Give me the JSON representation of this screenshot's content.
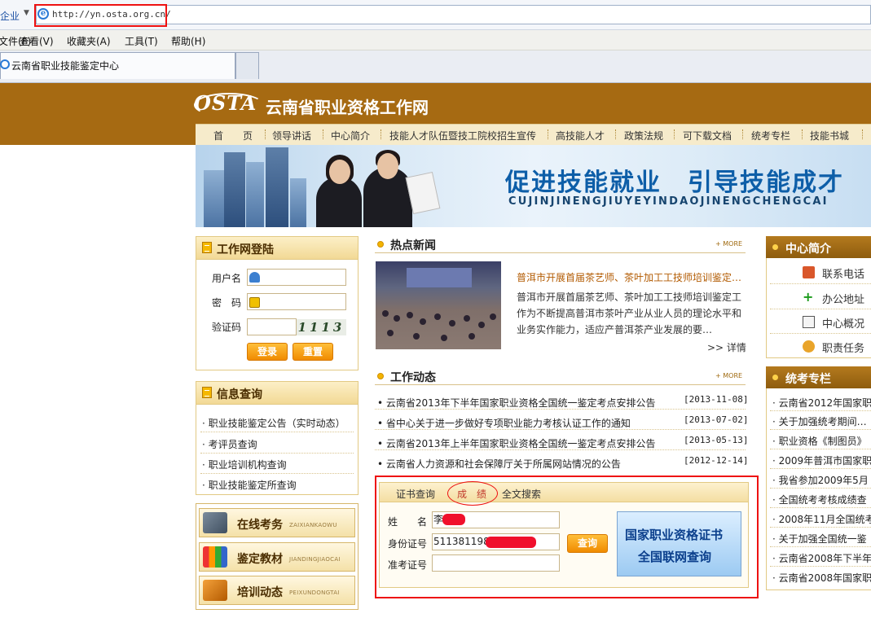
{
  "browser": {
    "left_label": "企业",
    "url": "http://yn.osta.org.cn/",
    "menu": [
      "文件(F)",
      "查看(V)",
      "收藏夹(A)",
      "工具(T)",
      "帮助(H)"
    ],
    "tab_title": "云南省职业技能鉴定中心"
  },
  "site": {
    "logo": "OSTA",
    "name": "云南省职业资格工作网",
    "nav": [
      "首　　页",
      "领导讲话",
      "中心简介",
      "技能人才队伍暨技工院校招生宣传",
      "高技能人才",
      "政策法规",
      "可下载文档",
      "统考专栏",
      "技能书城"
    ],
    "banner_slogan": "促进技能就业　引导技能成才",
    "banner_pinyin": "CUJINJINENGJIUYEYINDAOJINENGCHENGCAI"
  },
  "login": {
    "title": "工作网登陆",
    "user_label": "用户名",
    "pwd_label": "密　码",
    "code_label": "验证码",
    "captcha": "1113",
    "login_btn": "登录",
    "reset_btn": "重置"
  },
  "info": {
    "title": "信息查询",
    "items": [
      "职业技能鉴定公告（实时动态）",
      "考评员查询",
      "职业培训机构查询",
      "职业技能鉴定所查询"
    ]
  },
  "quick": [
    {
      "label": "在线考务",
      "pinyin": "ZAIXIANKAOWU"
    },
    {
      "label": "鉴定教材",
      "pinyin": "JIANDINGJIAOCAI"
    },
    {
      "label": "培训动态",
      "pinyin": "PEIXUNDONGTAI"
    }
  ],
  "hot": {
    "title": "热点新闻",
    "more": "+ MORE",
    "headline": "普洱市开展首届茶艺师、茶叶加工工技师培训鉴定…",
    "body": [
      "普洱市开展首届茶艺师、茶叶加工工技师培训鉴定工",
      "作为不断提高普洱市茶叶产业从业人员的理论水平和",
      "业务实作能力，适应产普洱茶产业发展的要…"
    ],
    "detail": ">> 详情"
  },
  "dynamics": {
    "title": "工作动态",
    "more": "+ MORE",
    "items": [
      {
        "text": "云南省2013年下半年国家职业资格全国统一鉴定考点安排公告",
        "date": "[2013-11-08]"
      },
      {
        "text": "省中心关于进一步做好专项职业能力考核认证工作的通知",
        "date": "[2013-07-02]"
      },
      {
        "text": "云南省2013年上半年国家职业资格全国统一鉴定考点安排公告",
        "date": "[2013-05-13]"
      },
      {
        "text": "云南省人力资源和社会保障厅关于所属网站情况的公告",
        "date": "[2012-12-14]"
      }
    ]
  },
  "query": {
    "tabs": [
      "证书查询",
      "成　绩",
      "全文搜索"
    ],
    "name_label": "姓　　名",
    "name_value": "李",
    "id_label": "身份证号",
    "id_value": "5113811988",
    "exam_label": "准考证号",
    "exam_value": "",
    "btn": "查询",
    "cert_line1": "国家职业资格证书",
    "cert_line2": "全国联网查询"
  },
  "center": {
    "title": "中心简介",
    "items": [
      "联系电话",
      "办公地址",
      "中心概况",
      "职责任务"
    ]
  },
  "exam": {
    "title": "统考专栏",
    "items": [
      "云南省2012年国家职",
      "关于加强统考期间… ",
      "职业资格《制图员》",
      "2009年普洱市国家职",
      "我省参加2009年5月",
      "全国统考考核成绩查",
      "2008年11月全国统考",
      "关于加强全国统一鉴",
      "云南省2008年下半年",
      "云南省2008年国家职"
    ]
  },
  "colors": {
    "brand": "#a66a12",
    "highlight": "#ee1111"
  }
}
